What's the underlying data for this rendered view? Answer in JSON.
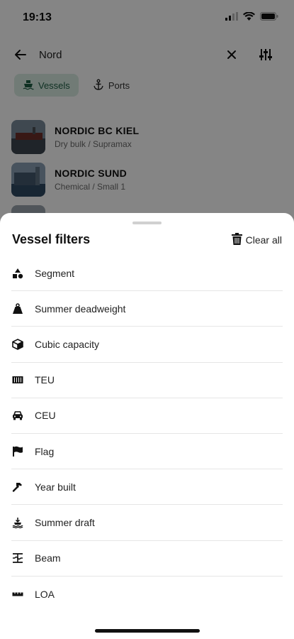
{
  "status_bar": {
    "time": "19:13"
  },
  "search": {
    "query": "Nord"
  },
  "tabs": [
    {
      "label": "Vessels",
      "active": true
    },
    {
      "label": "Ports",
      "active": false
    }
  ],
  "vessels": [
    {
      "name": "NORDIC BC KIEL",
      "subtitle": "Dry bulk / Supramax"
    },
    {
      "name": "NORDIC SUND",
      "subtitle": "Chemical / Small 1"
    }
  ],
  "sheet": {
    "title": "Vessel filters",
    "clear_all_label": "Clear all",
    "filters": [
      {
        "label": "Segment",
        "icon": "shapes-icon"
      },
      {
        "label": "Summer deadweight",
        "icon": "weight-icon"
      },
      {
        "label": "Cubic capacity",
        "icon": "cube-icon"
      },
      {
        "label": "TEU",
        "icon": "container-icon"
      },
      {
        "label": "CEU",
        "icon": "car-icon"
      },
      {
        "label": "Flag",
        "icon": "flag-icon"
      },
      {
        "label": "Year built",
        "icon": "hammer-icon"
      },
      {
        "label": "Summer draft",
        "icon": "draft-icon"
      },
      {
        "label": "Beam",
        "icon": "beam-icon"
      },
      {
        "label": "LOA",
        "icon": "length-icon"
      }
    ]
  },
  "colors": {
    "accent_tab_bg": "#d9ece3",
    "accent_tab_text": "#1e5e43",
    "scrim": "rgba(0,0,0,0.48)"
  }
}
